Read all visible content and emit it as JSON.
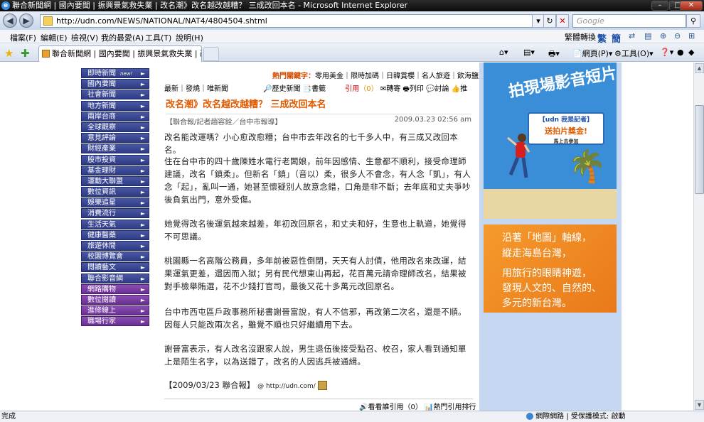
{
  "window": {
    "title": "聯合新聞網 | 國內要聞 | 振興景氣救失業 | 改名潮》改名越改越糟？ 三成改回本名 - Microsoft Internet Explorer",
    "minimize": "–",
    "maximize": "□",
    "close": "✕"
  },
  "addressbar": {
    "url": "http://udn.com/NEWS/NATIONAL/NAT4/4804504.shtml",
    "search_placeholder": "Google"
  },
  "menubar": {
    "items": [
      "檔案(F)",
      "編輯(E)",
      "檢視(V)",
      "我的最愛(A)",
      "工具(T)",
      "說明(H)"
    ],
    "right_items": [
      "繁體轉換",
      "繁",
      "簡"
    ]
  },
  "tabbar": {
    "tab_title": "聯合新聞網 | 國內要聞 | 振興景氣救失業 | 改名潮...",
    "tools": [
      "網頁(P)",
      "工具(O)"
    ]
  },
  "leftnav": {
    "items": [
      {
        "label": "即時新聞",
        "tag": "new!",
        "style": "blue"
      },
      {
        "label": "國內要聞",
        "style": "blue"
      },
      {
        "label": "社會新聞",
        "style": "blue"
      },
      {
        "label": "地方新聞",
        "style": "blue"
      },
      {
        "label": "兩岸台商",
        "style": "blue"
      },
      {
        "label": "全球觀察",
        "style": "blue"
      },
      {
        "label": "意見評論",
        "style": "blue"
      },
      {
        "label": "財經產業",
        "style": "blue"
      },
      {
        "label": "股市投資",
        "style": "blue"
      },
      {
        "label": "基金理財",
        "style": "blue"
      },
      {
        "label": "運動大聯盟",
        "style": "blue"
      },
      {
        "label": "數位資訊",
        "style": "blue"
      },
      {
        "label": "娛樂追星",
        "style": "blue"
      },
      {
        "label": "消費流行",
        "style": "blue"
      },
      {
        "label": "生活天氣",
        "style": "blue"
      },
      {
        "label": "健康醫藥",
        "style": "blue"
      },
      {
        "label": "旅遊休閒",
        "style": "blue"
      },
      {
        "label": "校園博覽會",
        "style": "blue"
      },
      {
        "label": "閱讀藝文",
        "style": "blue"
      },
      {
        "label": "聯合影音網",
        "style": "blue"
      },
      {
        "label": "網路購物",
        "style": "purple"
      },
      {
        "label": "數位閱讀",
        "style": "purple"
      },
      {
        "label": "進修線上",
        "style": "purple"
      },
      {
        "label": "職場行家",
        "style": "purple"
      }
    ]
  },
  "hotwords": {
    "label": "熱門關鍵字：",
    "words": "零用美金｜限時加碼｜日韓賞櫻｜名人旅遊｜飲海鹽藍"
  },
  "subnav": {
    "links": "最新｜發燒｜唯新聞",
    "tools_text": "🔎歷史新聞 📑書籤",
    "cite_label": "引用",
    "cite_count": "（0）",
    "rest": " ✉轉寄 🖶列印 💬討論 👍推"
  },
  "article": {
    "headline": "改名潮》改名越改越糟？ 三成改回本名",
    "byline": "【聯合報/記者趙容銓／台中市報導】",
    "datetime": "2009.03.23 02:56 am",
    "paragraphs": [
      "改名能改運嗎？小心愈改愈糟；台中市去年改名的七千多人中，有三成又改回本名。",
      "住在台中市的四十歲陳姓水電行老闆娘，前年因感情、生意都不順利，接受命理師建議，改名「鎮柔」。但新名「鎮」（音以）柔，很多人不會念，有人念「凱」，有人念「起」，亂叫一通，她甚至懷疑別人故意念錯，口角是非不斷；去年底和丈夫爭吵後負氣出門，意外受傷。",
      "她覺得改名後運氣越來越差，年初改回原名，和丈夫和好，生意也上軌道，她覺得不可思議。",
      "桃園縣一名高階公務員，多年前被惡性倒閉，天天有人討債，他用改名來改運，結果運氣更差，還因而入獄；另有民代想東山再起，花百萬元請命理師改名，結果被對手檢舉賄選，花不少錢打官司，最後又花十多萬元改回原名。",
      "台中市西屯區戶政事務所秘書謝晉富說，有人不信邪，再改第二次名，還是不順。因每人只能改兩次名，雖覺不順也只好繼續用下去。",
      "謝晉富表示，有人改名沒跟家人說，男生退伍後接受點召、校召，家人看到通知單上是陌生名字，以為送錯了，改名的人因逃兵被通緝。"
    ],
    "signature": "【2009/03/23 聯合報】",
    "signature_url": "@ http://udn.com/",
    "bottom_links": "🔊看看誰引用（0）  📊熱門引用排行"
  },
  "ads": {
    "ad1_big": "拍現場影音短片",
    "ad1_sign_top": "【udn 我是記者】",
    "ad1_sign_main": "送拍片獎金!",
    "ad1_sign_small": "馬上去參加",
    "ad2_lines": [
      "沿著「地圖」軸線，",
      "縱走海島台灣，",
      "用旅行的眼睛神遊，",
      "發現人文的、自然的、",
      "多元的新台灣。"
    ]
  },
  "statusbar": {
    "left": "完成",
    "right": "網際網路 | 受保護模式: 啟動"
  }
}
